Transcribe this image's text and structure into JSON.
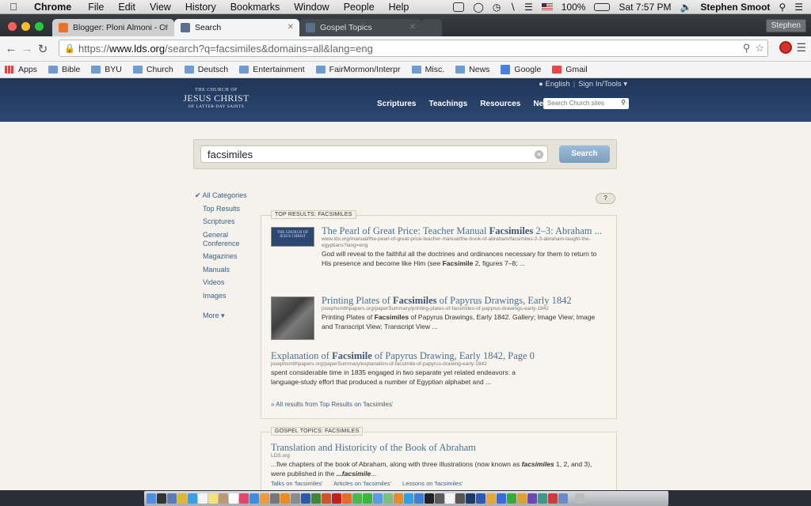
{
  "menubar": {
    "app": "Chrome",
    "items": [
      "File",
      "Edit",
      "View",
      "History",
      "Bookmarks",
      "Window",
      "People",
      "Help"
    ],
    "battery": "100%",
    "clock": "Sat 7:57 PM",
    "user": "Stephen Smoot"
  },
  "tabs": [
    {
      "label": "Blogger: Ploni Almoni - Cr",
      "favicon": "blogger-icon",
      "color": "#e8722a"
    },
    {
      "label": "Search",
      "favicon": "lds-icon",
      "color": "#5a6f8a"
    },
    {
      "label": "Gospel Topics",
      "favicon": "lds-icon",
      "color": "#5a6f8a"
    }
  ],
  "profile": "Stephen",
  "toolbar": {
    "url_scheme": "https://",
    "url_host": "www.lds.org",
    "url_path": "/search?q=facsimiles&domains=all&lang=eng"
  },
  "bookmarks": [
    {
      "label": "Apps",
      "icon": "apps-grid-icon"
    },
    {
      "label": "Bible",
      "icon": "folder-icon"
    },
    {
      "label": "BYU",
      "icon": "folder-icon"
    },
    {
      "label": "Church",
      "icon": "folder-icon"
    },
    {
      "label": "Deutsch",
      "icon": "folder-icon"
    },
    {
      "label": "Entertainment",
      "icon": "folder-icon"
    },
    {
      "label": "FairMormon/Interpre",
      "icon": "folder-icon"
    },
    {
      "label": "Misc.",
      "icon": "folder-icon"
    },
    {
      "label": "News",
      "icon": "folder-icon"
    },
    {
      "label": "Google",
      "icon": "google-icon"
    },
    {
      "label": "Gmail",
      "icon": "gmail-icon"
    }
  ],
  "site": {
    "logo_line1": "THE CHURCH OF",
    "logo_line2": "JESUS CHRIST",
    "logo_line3": "OF LATTER-DAY SAINTS",
    "lang": "English",
    "signin": "Sign In/Tools",
    "nav": [
      "Scriptures",
      "Teachings",
      "Resources",
      "News"
    ],
    "search_placeholder": "Search Church sites"
  },
  "search": {
    "query": "facsimiles",
    "button": "Search",
    "help": "?"
  },
  "categories": {
    "active": "All Categories",
    "items": [
      "Top Results",
      "Scriptures",
      "General Conference",
      "Magazines",
      "Manuals",
      "Videos",
      "Images"
    ],
    "more": "More ▾"
  },
  "top_results": {
    "label": "TOP RESULTS: FACSIMILES",
    "items": [
      {
        "title_pre": "The Pearl of Great Price: Teacher Manual ",
        "title_bold": "Facsimiles",
        "title_post": " 2–3: Abraham ...",
        "url": "www.lds.org/manual/the-pearl-of-great-price-teacher-manual/the-book-of-abraham/facsimiles-2-3-abraham-taught-the-egyptians?lang=eng",
        "desc_pre": "God will reveal to the faithful all the doctrines and ordinances necessary for them to return to His presence and become like Him (see ",
        "desc_bold": "Facsimile",
        "desc_post": " 2, figures 7–8; ..."
      },
      {
        "title_pre": "Printing Plates of ",
        "title_bold": "Facsimiles",
        "title_post": " of Papyrus Drawings, Early 1842",
        "url": "josephsmithpapers.org/paperSummary/printing-plates-of-facsimiles-of-papyrus-drawings-early-1842",
        "desc_pre": "Printing Plates of ",
        "desc_bold": "Facsimiles",
        "desc_post": " of Papyrus Drawings, Early 1842. Gallery; Image View; Image and Transcript View; Transcript View ..."
      },
      {
        "title_pre": "Explanation of ",
        "title_bold": "Facsimile",
        "title_post": " of Papyrus Drawing, Early 1842, Page 0",
        "url": "josephsmithpapers.org/paperSummary/explanation-of-facsimile-of-papyrus-drawing-early-1842",
        "desc_pre": "spent considerable time in 1835 engaged in two separate yet related endeavors: a language-study effort that produced a number of Egyptian alphabet and ...",
        "desc_bold": "",
        "desc_post": ""
      }
    ],
    "all_link": "» All results from Top Results on 'facsimiles'"
  },
  "gospel_topics": {
    "label": "GOSPEL TOPICS: FACSIMILES",
    "title": "Translation and Historicity of the Book of Abraham",
    "url": "LDS.org",
    "desc_pre": "...five chapters of the book of Abraham, along with three illustrations (now known as ",
    "desc_bold": "facsimiles",
    "desc_mid": " 1, 2, and 3), were published in the ",
    "desc_bold2": "...facsimile",
    "desc_post": "...",
    "links": [
      "Talks on 'facsimiles'",
      "Articles on 'facsimiles'",
      "Lessons on 'facsimiles'"
    ]
  }
}
